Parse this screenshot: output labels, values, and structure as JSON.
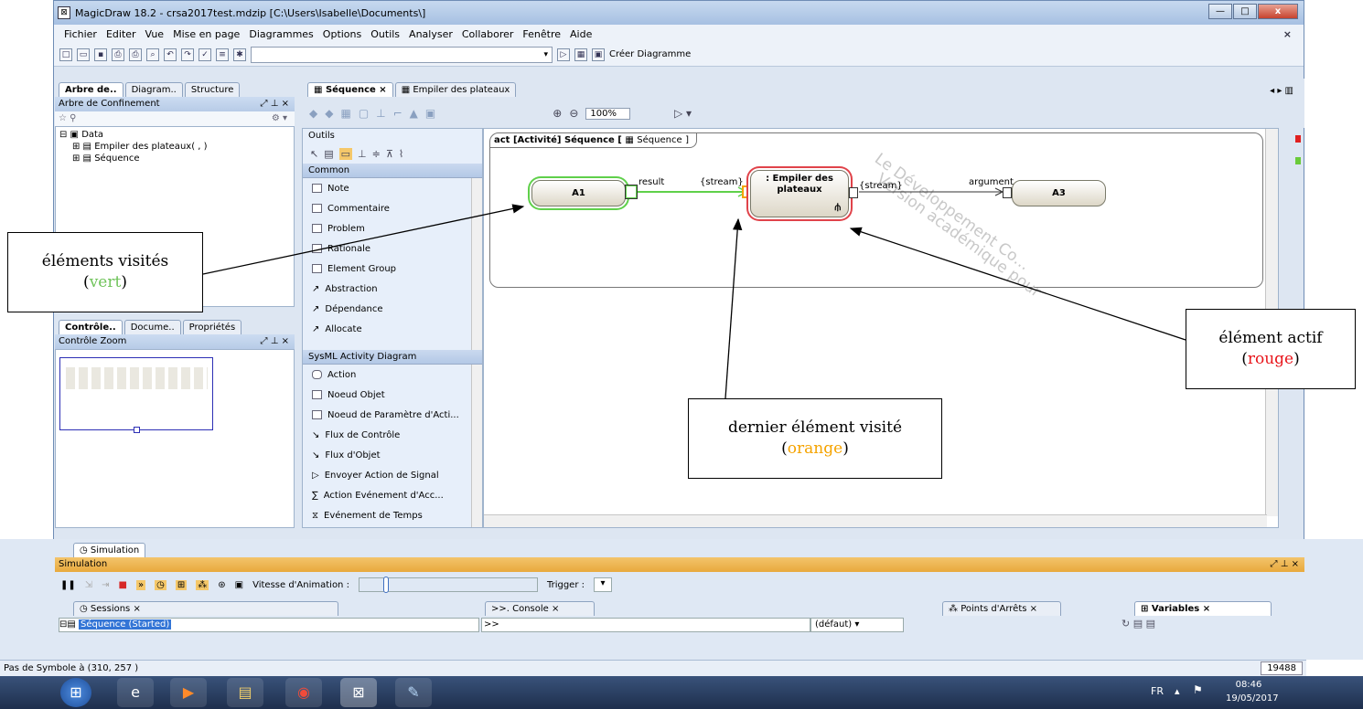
{
  "window": {
    "title": "MagicDraw 18.2 - crsa2017test.mdzip [C:\\Users\\Isabelle\\Documents\\]",
    "minimize": "—",
    "maximize": "□",
    "close": "x"
  },
  "menu": [
    "Fichier",
    "Editer",
    "Vue",
    "Mise en page",
    "Diagrammes",
    "Options",
    "Outils",
    "Analyser",
    "Collaborer",
    "Fenêtre",
    "Aide"
  ],
  "menu_close": "×",
  "toolbar": {
    "create_diagram": "Créer Diagramme"
  },
  "left_tabs": [
    "Arbre de..",
    "Diagram..",
    "Structure"
  ],
  "containment": {
    "header": "Arbre de Confinement",
    "tree": [
      "Data",
      "Empiler des plateaux( , )",
      "Séquence"
    ]
  },
  "lower_left_tabs": [
    "Contrôle..",
    "Docume..",
    "Propriétés"
  ],
  "zoom_panel": {
    "header": "Contrôle Zoom"
  },
  "editor_tabs": [
    "Séquence",
    "Empiler des plateaux"
  ],
  "zoom_level": "100%",
  "palette": {
    "title": "Outils",
    "group1": "Common",
    "group1_items": [
      "Note",
      "Commentaire",
      "Problem",
      "Rationale",
      "Element Group",
      "Abstraction",
      "Dépendance",
      "Allocate"
    ],
    "group2": "SysML Activity Diagram",
    "group2_items": [
      "Action",
      "Noeud Objet",
      "Noeud de Paramètre d'Acti...",
      "Flux de Contrôle",
      "Flux d'Objet",
      "Envoyer Action de Signal",
      "Action Evénement d'Acc...",
      "Evénement de Temps"
    ]
  },
  "diagram": {
    "frame_prefix": "act [Activité] Séquence [",
    "frame_ref": "Séquence",
    "frame_suffix": "]",
    "node_a1": "A1",
    "node_empiler_l1": ": Empiler des",
    "node_empiler_l2": "plateaux",
    "node_a3": "A3",
    "pin_result": "result",
    "stream1": "{stream}",
    "stream2": "{stream}",
    "pin_argument": "argument",
    "watermark_l1": "Version académique pour",
    "watermark_l2": "Le Développement Co..."
  },
  "callouts": {
    "visited": {
      "line1": "éléments visités",
      "line2": "vert",
      "color": "#6fc35a"
    },
    "active": {
      "line1": "élément actif",
      "line2": "rouge",
      "color": "#e8151b"
    },
    "last": {
      "line1": "dernier élément visité",
      "line2": "orange",
      "color": "#f5a300"
    }
  },
  "simulation": {
    "tab": "Simulation",
    "header": "Simulation",
    "speed_label": "Vitesse d'Animation :",
    "trigger_label": "Trigger :",
    "sessions_tab": "Sessions",
    "session_item": "Séquence (Started)",
    "console_tab": ">>. Console",
    "console_prompt": ">>",
    "console_default": "(défaut)",
    "breakpoints_tab": "Points d'Arrêts",
    "variables_tab": "Variables"
  },
  "status": {
    "text": "Pas de Symbole à (310, 257 )",
    "memory": "19488"
  },
  "taskbar": {
    "lang": "FR",
    "time": "08:46",
    "date": "19/05/2017"
  }
}
